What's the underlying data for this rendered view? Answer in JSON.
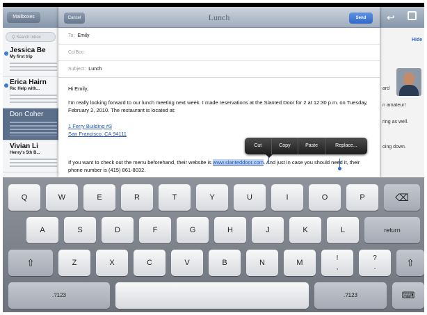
{
  "mail": {
    "mailboxes_button": "Mailboxes",
    "search_placeholder": "Q Search Inbox",
    "hide_link": "Hide",
    "messages": [
      {
        "sender": "Jessica Be",
        "subject": "My first trip",
        "unread": true
      },
      {
        "sender": "Erica Hairn",
        "subject": "Re: Help with...",
        "unread": true
      },
      {
        "sender": "Don Coher",
        "subject": "",
        "unread": false
      },
      {
        "sender": "Vivian Li",
        "subject": "Henry's 5th B...",
        "unread": false
      }
    ],
    "right_snippets": [
      "ard",
      "n amateur!",
      "ring as well.",
      "oing down."
    ]
  },
  "compose": {
    "cancel_label": "Cancel",
    "title": "Lunch",
    "send_label": "Send",
    "to_label": "To:",
    "to_value": "Emily",
    "cc_label": "Cc/Bcc:",
    "subject_label": "Subject:",
    "subject_value": "Lunch",
    "greeting": "Hi Emily,",
    "paragraph1": "I'm really looking forward to our lunch meeting next week. I made reservations at the Slanted Door for 2 at 12:30 p.m. on Tuesday, February 2, 2010. The restaurant is located at:",
    "address_line1": "1 Ferry Building #3",
    "address_line2": "San Francisco, CA 94111",
    "paragraph2_before": "If you want to check out the menu beforehand, their website is ",
    "website": "www.slanteddoor.com",
    "paragraph2_after": ". And just in case you should need it, their phone number is (415) 861-8032."
  },
  "edit_menu": [
    "Cut",
    "Copy",
    "Paste",
    "Replace..."
  ],
  "keyboard": {
    "row1": [
      "Q",
      "W",
      "E",
      "R",
      "T",
      "Y",
      "U",
      "I",
      "O",
      "P"
    ],
    "delete_icon": "⌫",
    "row2": [
      "A",
      "S",
      "D",
      "F",
      "G",
      "H",
      "J",
      "K",
      "L"
    ],
    "return_label": "return",
    "shift_icon": "⇧",
    "row3": [
      "Z",
      "X",
      "C",
      "V",
      "B",
      "N",
      "M"
    ],
    "exclaim_top": "!",
    "exclaim_bottom": ",",
    "question_top": "?",
    "question_bottom": ".",
    "numbers_label": ".?123",
    "hide_keyboard_icon": "⌨"
  },
  "colors": {
    "accent": "#2f68c8",
    "selection": "#bcd3f3",
    "keyboard": "#7c818a"
  }
}
